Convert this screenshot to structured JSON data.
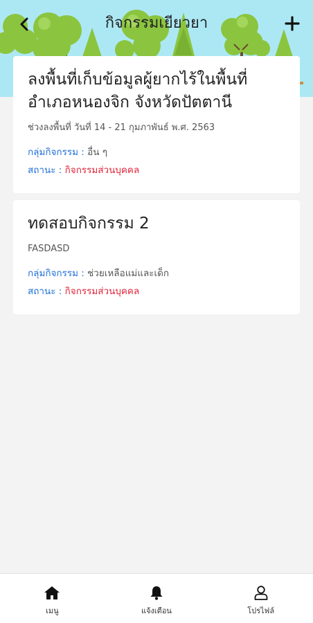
{
  "header": {
    "title": "กิจกรรมเยียวยา",
    "back_icon": "chevron-left-icon",
    "add_icon": "plus-icon",
    "background_color": "#ace8f4"
  },
  "activities": [
    {
      "title": "ลงพื้นที่เก็บข้อมูลผู้ยากไร้ในพื้นที่ อำเภอหนองจิก จังหวัดปัตตานี",
      "subtitle": "ช่วงลงพื้นที่ วันที่ 14 - 21 กุมภาพันธ์ พ.ศ. 2563",
      "group_label": "กลุ่มกิจกรรม :",
      "group_value": "อื่น ๆ",
      "status_label": "สถานะ :",
      "status_value": "กิจกรรมส่วนบุคคล"
    },
    {
      "title": "ทดสอบกิจกรรม 2",
      "subtitle": "FASDASD",
      "group_label": "กลุ่มกิจกรรม :",
      "group_value": "ช่วยเหลือแม่และเด็ก",
      "status_label": "สถานะ :",
      "status_value": "กิจกรรมส่วนบุคคล"
    }
  ],
  "nav": {
    "items": [
      {
        "label": "เมนู",
        "icon": "home-icon"
      },
      {
        "label": "แจ้งเตือน",
        "icon": "bell-icon"
      },
      {
        "label": "โปรไฟล์",
        "icon": "user-icon"
      }
    ]
  },
  "colors": {
    "label_blue": "#1f6fd8",
    "status_red": "#e0243a",
    "tree_green": "#8bc53f"
  }
}
